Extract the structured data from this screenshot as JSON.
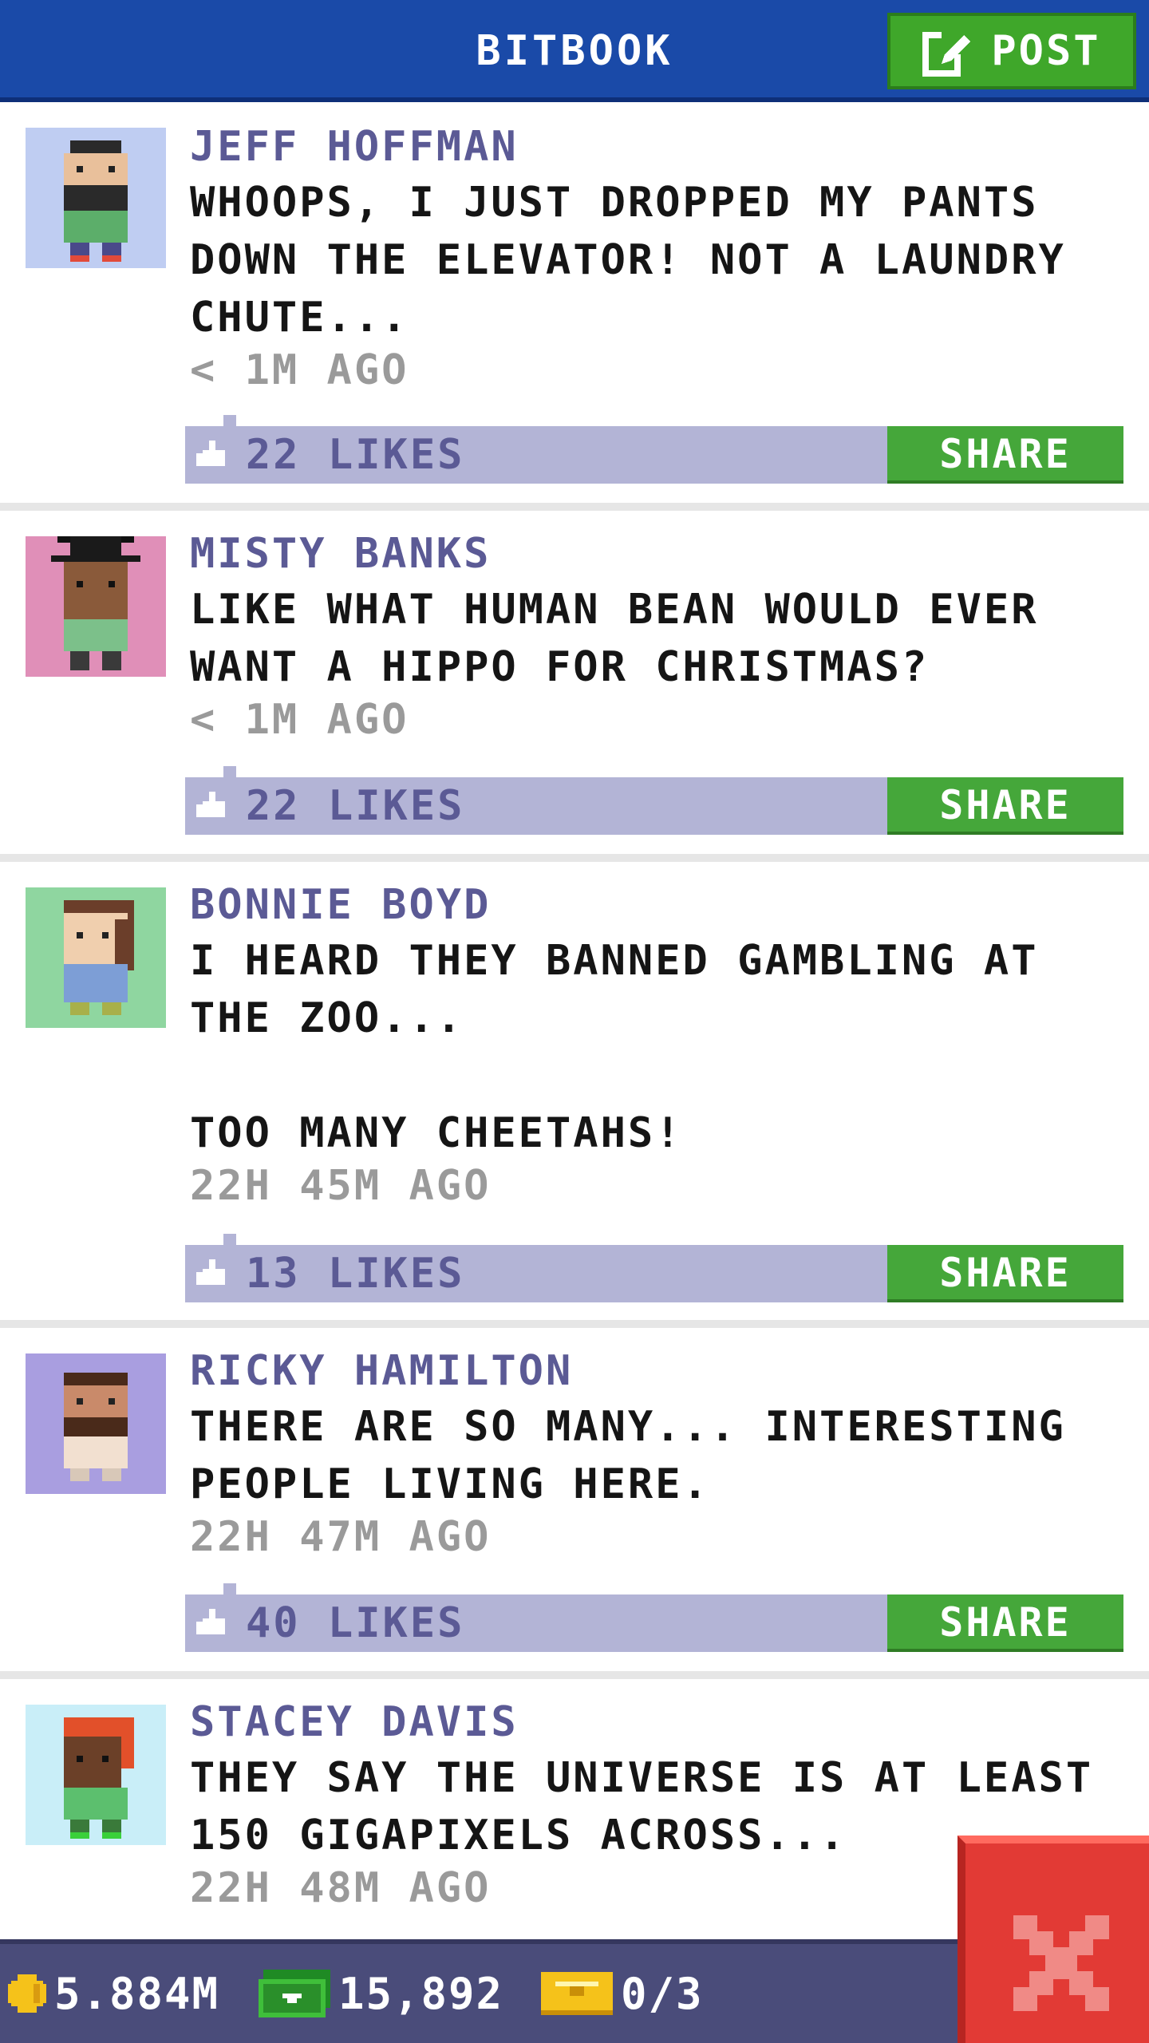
{
  "header": {
    "title": "BITBOOK",
    "post_label": "POST"
  },
  "posts": [
    {
      "author": "JEFF HOFFMAN",
      "message": "WHOOPS, I JUST DROPPED MY PANTS\nDOWN THE ELEVATOR! NOT A LAUNDRY\nCHUTE...",
      "time": "< 1M AGO",
      "likes": "22 LIKES",
      "share": "SHARE"
    },
    {
      "author": "MISTY BANKS",
      "message": "LIKE WHAT HUMAN BEAN WOULD EVER\nWANT A HIPPO FOR CHRISTMAS?",
      "time": "< 1M AGO",
      "likes": "22 LIKES",
      "share": "SHARE"
    },
    {
      "author": "BONNIE BOYD",
      "message": "I HEARD THEY BANNED GAMBLING AT\nTHE ZOO...\n\nTOO MANY CHEETAHS!",
      "time": "22H 45M AGO",
      "likes": "13 LIKES",
      "share": "SHARE"
    },
    {
      "author": "RICKY HAMILTON",
      "message": "THERE ARE SO MANY... INTERESTING\nPEOPLE LIVING HERE.",
      "time": "22H 47M AGO",
      "likes": "40 LIKES",
      "share": "SHARE"
    },
    {
      "author": "STACEY DAVIS",
      "message": "THEY SAY THE UNIVERSE IS AT LEAST\n150 GIGAPIXELS ACROSS...",
      "time": "22H 48M AGO"
    }
  ],
  "status": {
    "coins": "5.884M",
    "bux": "15,892",
    "tickets": "0/3"
  },
  "colors": {
    "header": "#1a4aa8",
    "green": "#45a73a",
    "like_bar": "#b3b4d6",
    "author": "#5b5a95",
    "close": "#e23a35"
  },
  "icons": {
    "post": "edit-icon",
    "like": "thumbs-up-icon",
    "coin": "coin-icon",
    "bux": "bux-icon",
    "ticket": "ticket-icon",
    "close": "close-icon"
  }
}
